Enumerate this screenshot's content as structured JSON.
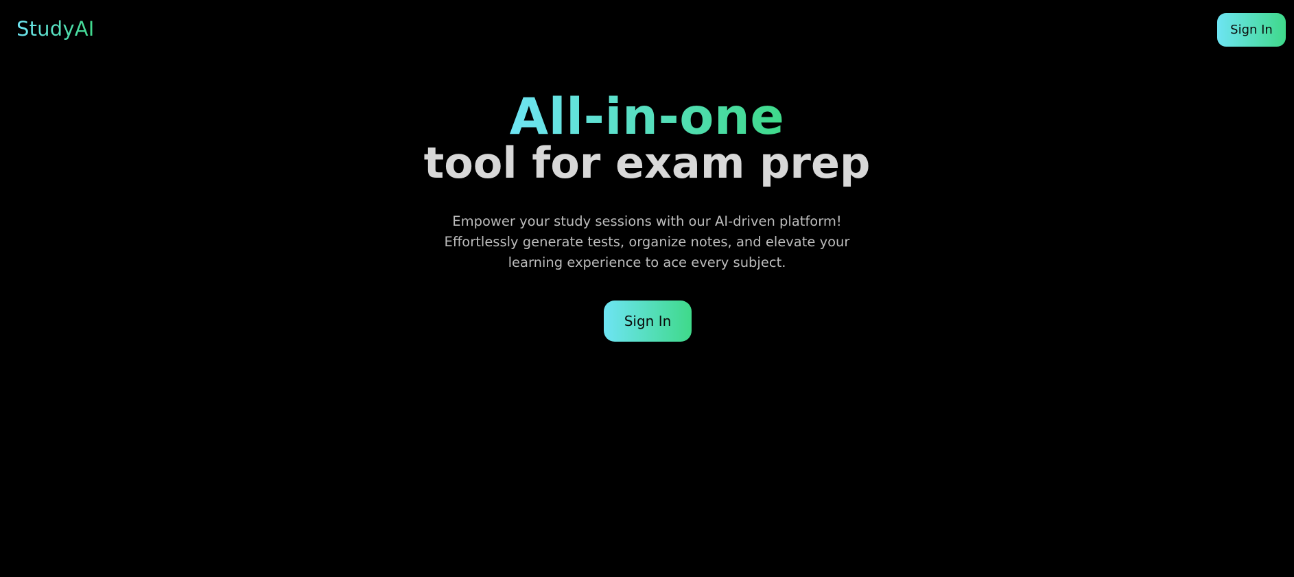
{
  "navbar": {
    "logo": "StudyAI",
    "signin_label": "Sign In"
  },
  "hero": {
    "headline_accent": "All-in-one",
    "headline_rest": "tool for exam prep",
    "description": "Empower your study sessions with our AI-driven platform! Effortlessly generate tests, organize notes, and elevate your learning experience to ace every subject.",
    "signin_label": "Sign In"
  },
  "colors": {
    "background": "#000000",
    "gradient_start": "#6ee4f3",
    "gradient_end": "#3fd98a",
    "headline_text": "#d8d8d8",
    "body_text": "#bdbdbd"
  }
}
